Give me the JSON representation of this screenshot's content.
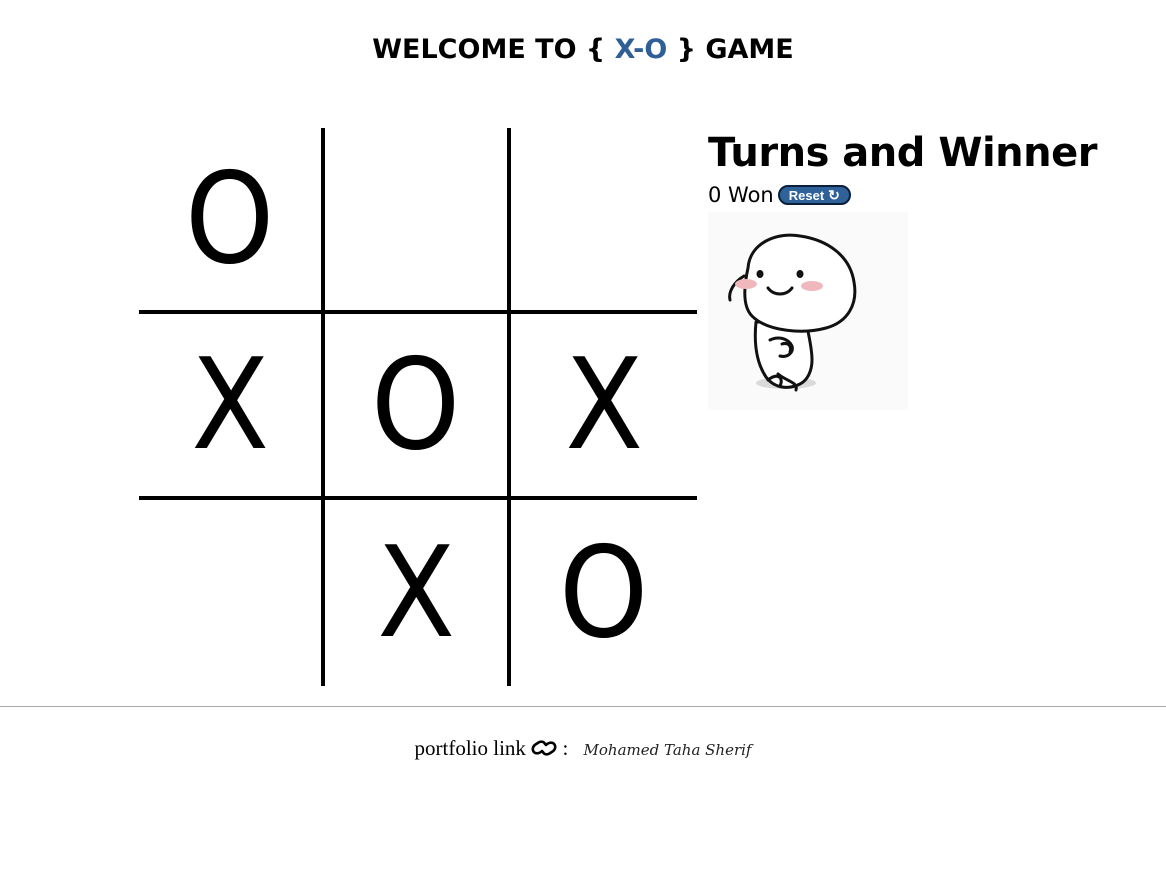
{
  "header": {
    "prefix": "WELCOME TO {",
    "accent": "X-O",
    "suffix": "} GAME"
  },
  "board": {
    "cells": [
      "O",
      "",
      "",
      "X",
      "O",
      "X",
      "",
      "X",
      "O"
    ]
  },
  "sidebar": {
    "title": "Turns and Winner",
    "status": "0 Won",
    "reset_label": "Reset",
    "reset_icon": "refresh-icon"
  },
  "footer": {
    "label": "portfolio link",
    "separator": ":",
    "author": "Mohamed Taha Sherif",
    "link_icon": "link-icon"
  },
  "colors": {
    "accent": "#2f5f96",
    "button": "#2e6298"
  }
}
